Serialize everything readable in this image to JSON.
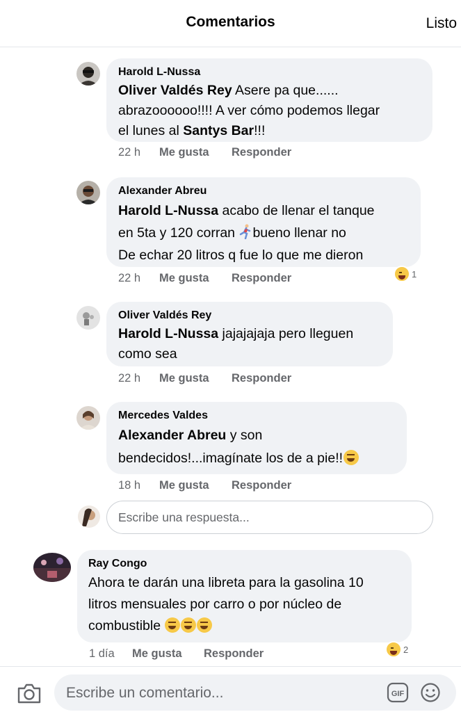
{
  "header": {
    "title": "Comentarios",
    "done_label": "Listo"
  },
  "comments": [
    {
      "author": "Harold L-Nussa",
      "tag": "Oliver Valdés Rey",
      "line1": " Asere pa que......",
      "line2": "abrazoooooo!!!! A ver cómo podemos llegar",
      "line3_pre": "el lunes al ",
      "line3_bold": "Santys Bar",
      "line3_post": "!!!",
      "time": "22 h",
      "like": "Me gusta",
      "reply": "Responder"
    },
    {
      "author": "Alexander Abreu",
      "tag": "Harold L-Nussa",
      "line1": " acabo de llenar el tanque",
      "line2_pre": "en 5ta y 120 corran ",
      "line2_post": "bueno llenar no",
      "line3": "De echar 20 litros q fue lo que me dieron",
      "time": "22 h",
      "like": "Me gusta",
      "reply": "Responder",
      "reaction_count": "1"
    },
    {
      "author": "Oliver Valdés Rey",
      "tag": "Harold L-Nussa",
      "line1": " jajajajaja pero lleguen",
      "line2": "como sea",
      "time": "22 h",
      "like": "Me gusta",
      "reply": "Responder"
    },
    {
      "author": "Mercedes Valdes",
      "tag": "Alexander Abreu",
      "line1": " y son",
      "line2": "bendecidos!...imagínate los de a pie!!",
      "time": "18 h",
      "like": "Me gusta",
      "reply": "Responder"
    }
  ],
  "reply_box": {
    "placeholder": "Escribe una respuesta..."
  },
  "top_comment": {
    "author": "Ray Congo",
    "line1": "Ahora te darán una libreta para la gasolina 10",
    "line2": "litros mensuales por carro o por núcleo  de",
    "line3": "combustible ",
    "time": "1 día",
    "like": "Me gusta",
    "reply": "Responder",
    "reaction_count": "2"
  },
  "bottom_bar": {
    "placeholder": "Escribe un comentario...",
    "gif_label": "GIF"
  },
  "colors": {
    "bubble": "#f0f2f5",
    "meta_text": "#65676b",
    "text": "#050505",
    "divider": "#e4e6eb"
  },
  "icons": [
    "camera-icon",
    "gif-icon",
    "smile-icon",
    "laughing-emoji-icon",
    "runner-emoji-icon",
    "thinking-emoji-icon",
    "rolling-laugh-emoji-icon"
  ]
}
